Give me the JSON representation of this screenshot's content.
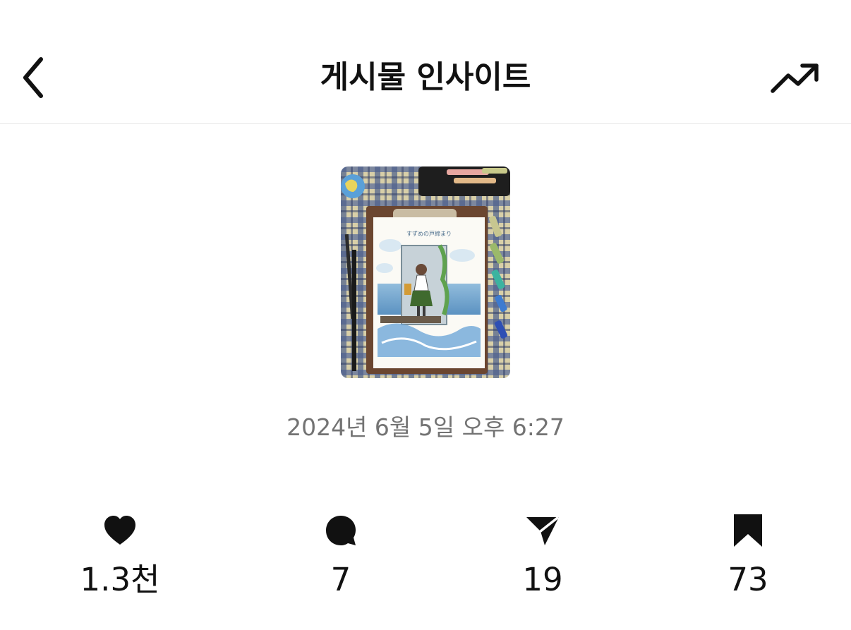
{
  "header": {
    "title": "게시물 인사이트",
    "back_icon": "chevron-left-icon",
    "trend_icon": "trending-up-icon"
  },
  "post": {
    "thumbnail": "illustration-thumbnail",
    "timestamp": "2024년 6월 5일 오후 6:27"
  },
  "stats": [
    {
      "icon": "heart-icon",
      "value": "1.3천"
    },
    {
      "icon": "comment-icon",
      "value": "7"
    },
    {
      "icon": "share-icon",
      "value": "19"
    },
    {
      "icon": "bookmark-icon",
      "value": "73"
    }
  ],
  "colors": {
    "text": "#111111",
    "muted": "#737373",
    "divider": "#e6e6e6"
  }
}
